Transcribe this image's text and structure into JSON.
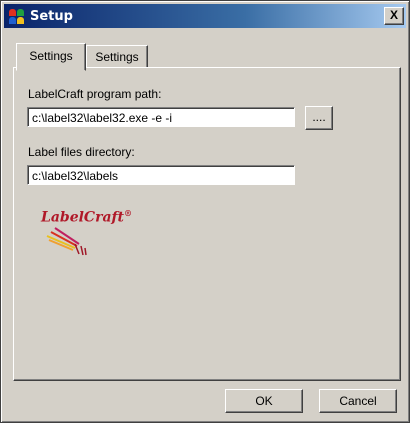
{
  "window": {
    "title": "Setup",
    "close_label": "X"
  },
  "tabs": [
    {
      "label": "Settings",
      "active": true
    },
    {
      "label": "Settings",
      "active": false
    }
  ],
  "settings": {
    "program_path_label": "LabelCraft program path:",
    "program_path_value": "c:\\label32\\label32.exe -e -i",
    "browse_label": "....",
    "label_dir_label": "Label files directory:",
    "label_dir_value": "c:\\label32\\labels"
  },
  "logo": {
    "text": "LabelCraft",
    "mark": "®"
  },
  "buttons": {
    "ok": "OK",
    "cancel": "Cancel"
  },
  "colors": {
    "title_bar": "#0a246a",
    "face": "#d4d0c8",
    "logo": "#b01828"
  }
}
